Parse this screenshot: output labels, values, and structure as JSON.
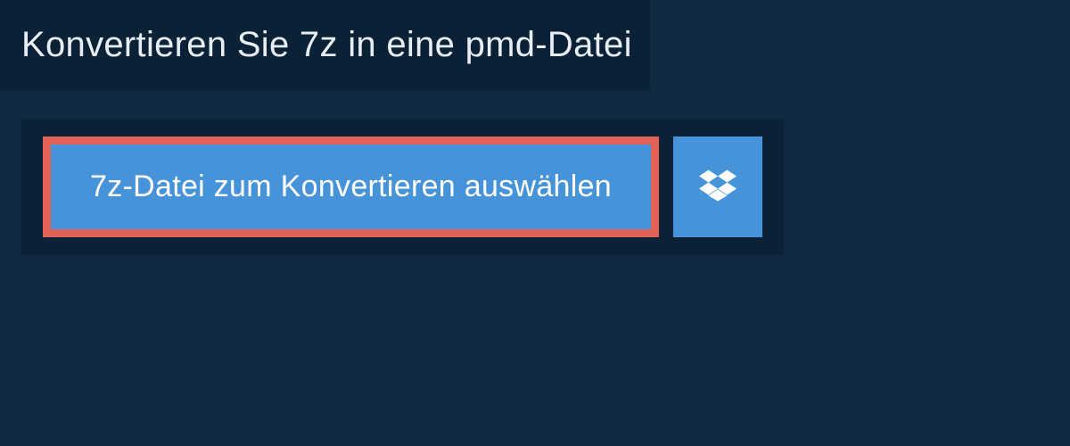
{
  "header": {
    "title": "Konvertieren Sie 7z in eine pmd-Datei"
  },
  "actions": {
    "select_file_label": "7z-Datei zum Konvertieren auswählen",
    "dropbox_icon": "dropbox-icon"
  },
  "colors": {
    "background": "#0f2940",
    "panel": "#0a2136",
    "button": "#4793d9",
    "highlight_border": "#e26258",
    "text": "#ffffff"
  }
}
